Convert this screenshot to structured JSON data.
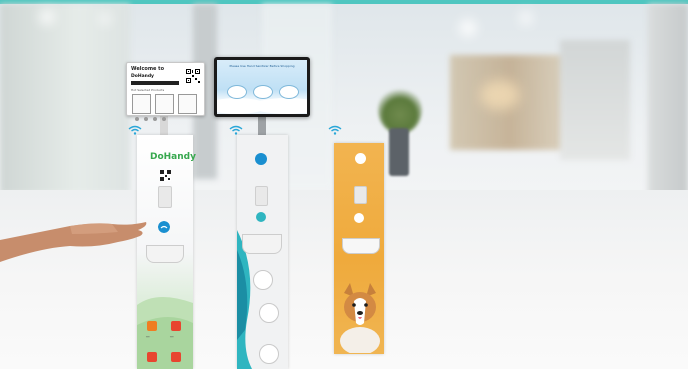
{
  "brand": "DoHandy",
  "screen_left": {
    "greeting": "Welcome to",
    "brand": "DoHandy",
    "section_label": "Hot Selected Products"
  },
  "screen_right": {
    "title": "Please Use Hand Sanitizer Before Shopping"
  },
  "colors": {
    "accent": "#4fc6c0",
    "brand_green": "#37a84e",
    "orange_panel": "#efaa3c",
    "hand_badge_blue": "#1a8fd0",
    "teal": "#2fb5c0"
  },
  "icons": [
    "wifi-icon",
    "qr-code-icon",
    "hand-wash-icon",
    "close-icon",
    "checklist-icon"
  ]
}
